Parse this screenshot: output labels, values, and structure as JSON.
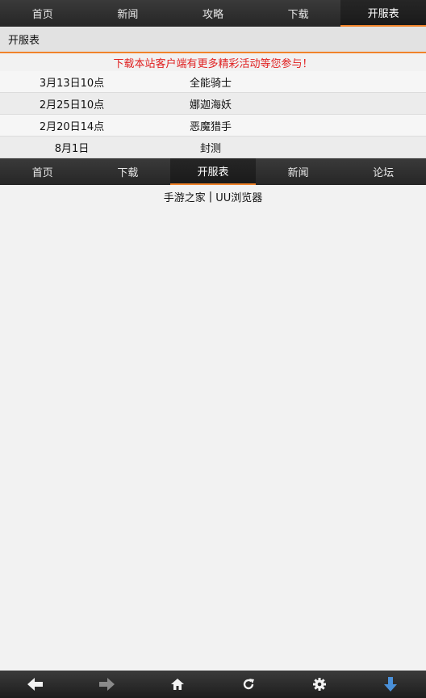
{
  "top_nav": {
    "items": [
      "首页",
      "新闻",
      "攻略",
      "下载",
      "开服表"
    ],
    "active_index": 4
  },
  "section": {
    "title": "开服表"
  },
  "promo": {
    "text": "下载本站客户端有更多精彩活动等您参与！"
  },
  "schedule": {
    "rows": [
      {
        "date": "3月13日10点",
        "game": "全能骑士"
      },
      {
        "date": "2月25日10点",
        "game": "娜迦海妖"
      },
      {
        "date": "2月20日14点",
        "game": "恶魔猎手"
      },
      {
        "date": "8月1日",
        "game": "封测"
      }
    ]
  },
  "sub_nav": {
    "items": [
      "首页",
      "下载",
      "开服表",
      "新闻",
      "论坛"
    ],
    "active_index": 2
  },
  "footer": {
    "link1": "手游之家",
    "separator": "|",
    "link2": "UU浏览器"
  },
  "toolbar": {
    "icons": [
      "back-icon",
      "forward-icon",
      "home-icon",
      "refresh-icon",
      "settings-icon",
      "download-icon"
    ],
    "accent": "#f0832a",
    "download_color": "#4a90d9"
  }
}
